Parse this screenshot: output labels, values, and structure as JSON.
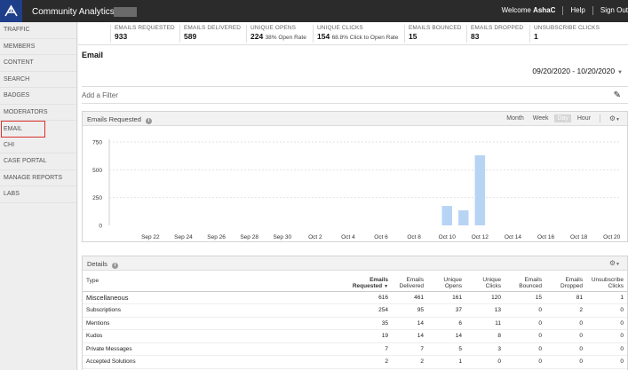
{
  "app": {
    "title": "Community Analytics"
  },
  "topbar": {
    "welcome_prefix": "Welcome",
    "user": "AshaC",
    "help": "Help",
    "signout": "Sign Out"
  },
  "sidebar": {
    "items": [
      {
        "label": "TRAFFIC"
      },
      {
        "label": "MEMBERS"
      },
      {
        "label": "CONTENT"
      },
      {
        "label": "SEARCH"
      },
      {
        "label": "BADGES"
      },
      {
        "label": "MODERATORS"
      },
      {
        "label": "EMAIL"
      },
      {
        "label": "CHI"
      },
      {
        "label": "CASE PORTAL"
      },
      {
        "label": "MANAGE REPORTS"
      },
      {
        "label": "LABS"
      }
    ],
    "active": "EMAIL"
  },
  "stats": [
    {
      "label": "EMAILS REQUESTED",
      "value": "933",
      "sub": ""
    },
    {
      "label": "EMAILS DELIVERED",
      "value": "589",
      "sub": ""
    },
    {
      "label": "UNIQUE OPENS",
      "value": "224",
      "sub": "38% Open Rate"
    },
    {
      "label": "UNIQUE CLICKS",
      "value": "154",
      "sub": "68.8% Click to Open Rate"
    },
    {
      "label": "EMAILS BOUNCED",
      "value": "15",
      "sub": ""
    },
    {
      "label": "EMAILS DROPPED",
      "value": "83",
      "sub": ""
    },
    {
      "label": "UNSUBSCRIBE CLICKS",
      "value": "1",
      "sub": ""
    }
  ],
  "page": {
    "title": "Email",
    "date_range": "09/20/2020 - 10/20/2020"
  },
  "filter": {
    "label": "Add a Filter"
  },
  "chart_panel": {
    "title": "Emails Requested",
    "granularity": [
      "Month",
      "Week",
      "Day",
      "Hour"
    ],
    "selected_granularity": "Day"
  },
  "chart_data": {
    "type": "bar",
    "title": "Emails Requested",
    "x_tick_labels": [
      "Sep 22",
      "Sep 24",
      "Sep 26",
      "Sep 28",
      "Sep 30",
      "Oct 2",
      "Oct 4",
      "Oct 6",
      "Oct 8",
      "Oct 10",
      "Oct 12",
      "Oct 14",
      "Oct 16",
      "Oct 18",
      "Oct 20"
    ],
    "y_ticks": [
      0,
      250,
      500,
      750
    ],
    "ylim": [
      0,
      750
    ],
    "categories": [
      "Oct 10",
      "Oct 11",
      "Oct 12"
    ],
    "values": [
      175,
      135,
      630
    ],
    "color": "#b7d4f5",
    "grid": true
  },
  "details_panel": {
    "title": "Details",
    "columns": [
      "Type",
      "Emails Requested",
      "Emails Delivered",
      "Unique Opens",
      "Unique Clicks",
      "Emails Bounced",
      "Emails Dropped",
      "Unsubscribe Clicks"
    ],
    "rows": [
      [
        "Miscellaneous",
        "616",
        "461",
        "161",
        "120",
        "15",
        "81",
        "1"
      ],
      [
        "Subscriptions",
        "254",
        "95",
        "37",
        "13",
        "0",
        "2",
        "0"
      ],
      [
        "Mentions",
        "35",
        "14",
        "6",
        "11",
        "0",
        "0",
        "0"
      ],
      [
        "Kudos",
        "19",
        "14",
        "14",
        "8",
        "0",
        "0",
        "0"
      ],
      [
        "Private Messages",
        "7",
        "7",
        "5",
        "3",
        "0",
        "0",
        "0"
      ],
      [
        "Accepted Solutions",
        "2",
        "2",
        "1",
        "0",
        "0",
        "0",
        "0"
      ]
    ]
  }
}
